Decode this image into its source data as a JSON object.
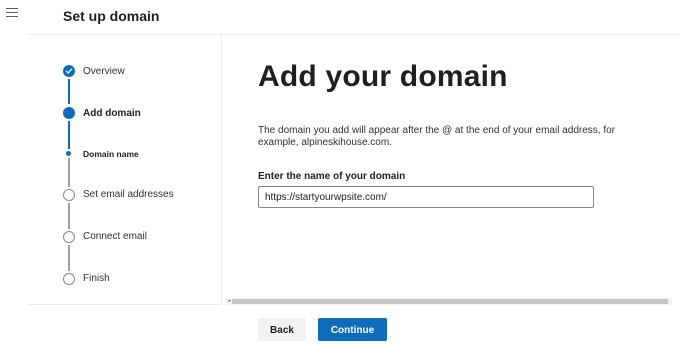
{
  "header": {
    "title": "Set up domain",
    "menu_icon": "hamburger-menu-icon"
  },
  "steps": [
    {
      "label": "Overview",
      "status": "completed"
    },
    {
      "label": "Add domain",
      "status": "current"
    },
    {
      "label": "Domain name",
      "status": "current-substep"
    },
    {
      "label": "Set email addresses",
      "status": "pending"
    },
    {
      "label": "Connect email",
      "status": "pending"
    },
    {
      "label": "Finish",
      "status": "pending"
    }
  ],
  "main": {
    "heading": "Add your domain",
    "description": "The domain you add will appear after the @ at the end of your email address, for example, alpineskihouse.com.",
    "field_label": "Enter the name of your domain",
    "domain_value": "https://startyourwpsite.com/"
  },
  "footer": {
    "back_label": "Back",
    "continue_label": "Continue"
  },
  "colors": {
    "accent": "#0f6cbd",
    "pending": "#8a8886"
  }
}
